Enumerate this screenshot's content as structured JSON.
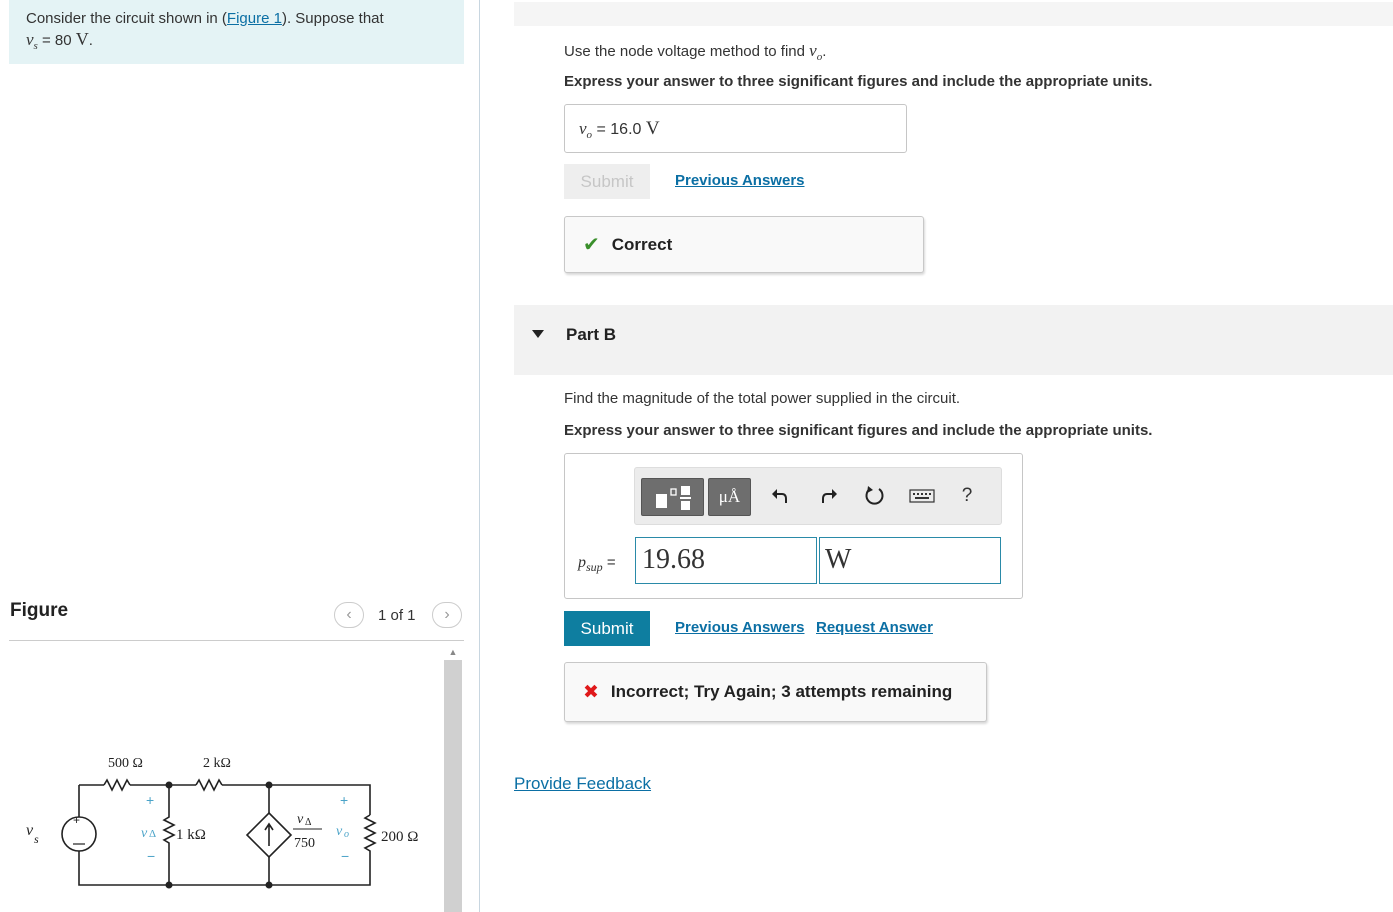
{
  "problem": {
    "line1_prefix": "Consider the circuit shown in (",
    "figure_link": "Figure 1",
    "line1_suffix": "). Suppose that",
    "vs_var": "v",
    "vs_sub": "s",
    "vs_value": " = 80 ",
    "vs_unit": "V",
    "vs_end": "."
  },
  "figure": {
    "title": "Figure",
    "pager": "1 of 1",
    "prev_icon": "‹",
    "next_icon": "›",
    "circuit": {
      "r1": "500 Ω",
      "r2": "2 kΩ",
      "r3": "1 kΩ",
      "r4": "200 Ω",
      "vs_label": "v",
      "vs_sub": "s",
      "vdelta_label": "v",
      "vdelta_sub": "Δ",
      "cs_num": "v",
      "cs_num_sub": "Δ",
      "cs_den": "750",
      "vo_label": "v",
      "vo_sub": "o",
      "plus": "+",
      "minus": "−"
    }
  },
  "part_a": {
    "question_prefix": "Use the node voltage method to find ",
    "question_var": "v",
    "question_sub": "o",
    "question_end": ".",
    "instruction": "Express your answer to three significant figures and include the appropriate units.",
    "answer_var": "v",
    "answer_sub": "o",
    "answer_eq": " = ",
    "answer_value": "16.0",
    "answer_unit": "V",
    "submit_label": "Submit",
    "previous_answers": "Previous Answers",
    "feedback_icon": "✔",
    "feedback_text": "Correct",
    "colors": {
      "correct": "#3a8f2b"
    }
  },
  "part_b": {
    "header": "Part B",
    "question": "Find the magnitude of the total power supplied in the circuit.",
    "instruction": "Express your answer to three significant figures and include the appropriate units.",
    "toolbar": {
      "templates_icon": "templates-icon",
      "units_label": "μÅ",
      "undo_icon": "undo-icon",
      "redo_icon": "redo-icon",
      "reset_icon": "reset-icon",
      "keyboard_icon": "keyboard-icon",
      "help_label": "?"
    },
    "answer_var": "p",
    "answer_sub": "sup",
    "answer_eq": " = ",
    "value": "19.68",
    "unit": "W",
    "submit_label": "Submit",
    "previous_answers": "Previous Answers",
    "request_answer": "Request Answer",
    "feedback_icon": "✖",
    "feedback_text": "Incorrect; Try Again; 3 attempts remaining",
    "colors": {
      "submit_bg": "#0e7ea0",
      "incorrect": "#e0191b"
    }
  },
  "provide_feedback": "Provide Feedback"
}
